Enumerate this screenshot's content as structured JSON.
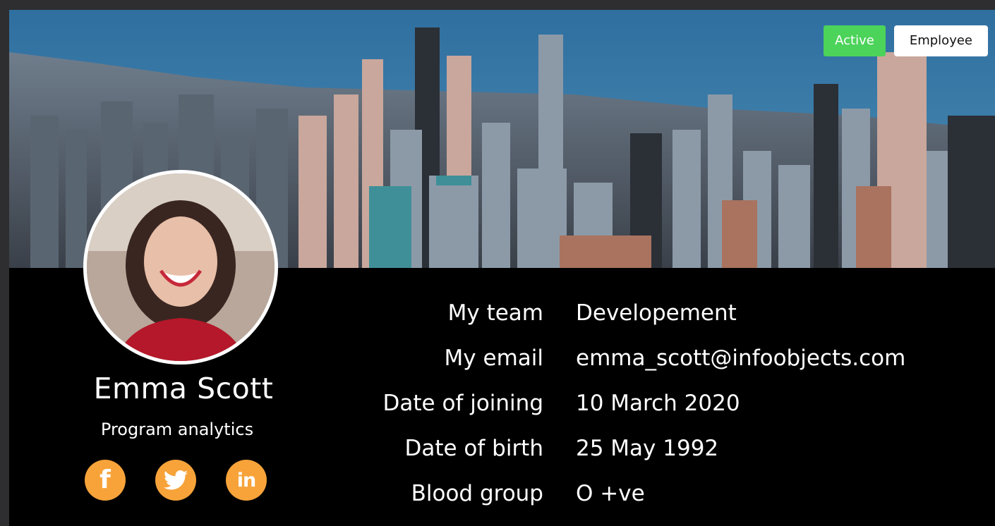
{
  "badges": {
    "status": "Active",
    "type": "Employee",
    "status_color": "#4cd35a"
  },
  "profile": {
    "name": "Emma Scott",
    "role": "Program analytics"
  },
  "socials": [
    {
      "name": "facebook-icon"
    },
    {
      "name": "twitter-icon"
    },
    {
      "name": "linkedin-icon"
    }
  ],
  "social_color": "#f7a33a",
  "details": {
    "team": {
      "label": "My team",
      "value": "Developement"
    },
    "email": {
      "label": "My email",
      "value": "emma_scott@infoobjects.com"
    },
    "joining": {
      "label": "Date of joining",
      "value": "10 March 2020"
    },
    "birth": {
      "label": "Date of birth",
      "value": "25 May 1992"
    },
    "blood": {
      "label": "Blood group",
      "value": "O +ve"
    }
  }
}
